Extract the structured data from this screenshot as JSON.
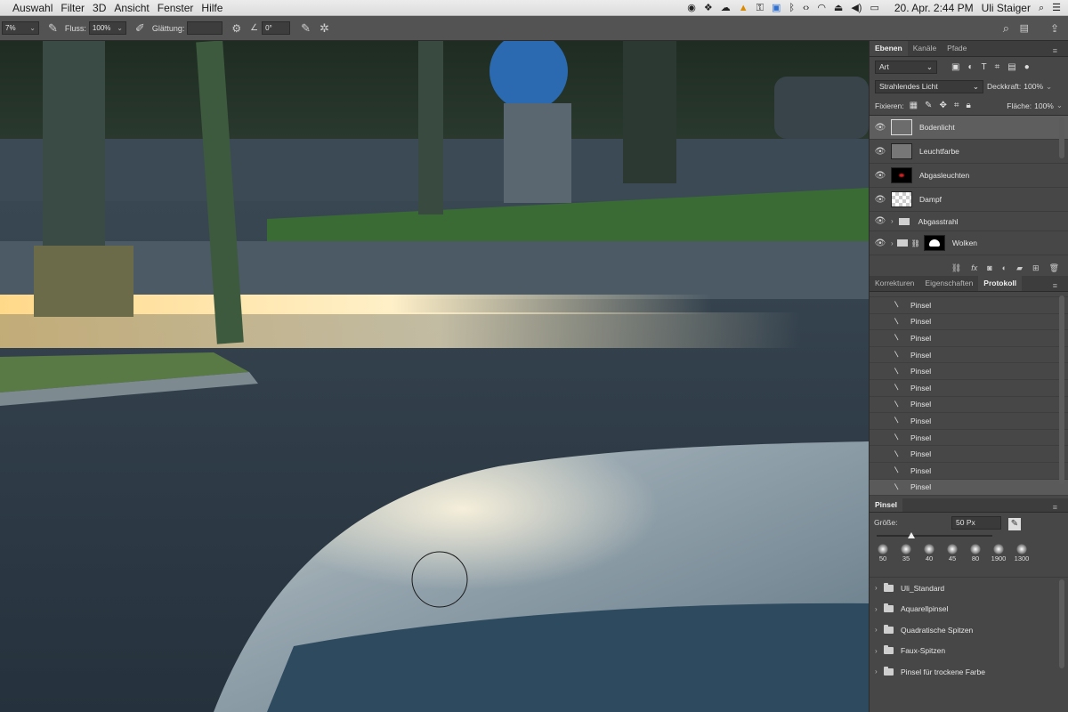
{
  "menubar": {
    "menus": [
      "Auswahl",
      "Filter",
      "3D",
      "Ansicht",
      "Fenster",
      "Hilfe"
    ],
    "datetime": "20. Apr.  2:44 PM",
    "user": "Uli Staiger"
  },
  "options": {
    "size_value": "7%",
    "flow_label": "Fluss:",
    "flow_value": "100%",
    "smoothing_label": "Glättung:",
    "smoothing_value": "",
    "angle_value": "0°"
  },
  "layers_panel": {
    "tabs": [
      "Ebenen",
      "Kanäle",
      "Pfade"
    ],
    "filter_kind": "Art",
    "blend_mode": "Strahlendes Licht",
    "opacity_label": "Deckkraft:",
    "opacity_value": "100%",
    "lock_label": "Fixieren:",
    "fill_label": "Fläche:",
    "fill_value": "100%",
    "layers": [
      {
        "name": "Bodenlicht",
        "type": "layer",
        "selected": true
      },
      {
        "name": "Leuchtfarbe",
        "type": "layer"
      },
      {
        "name": "Abgasleuchten",
        "type": "layer"
      },
      {
        "name": "Dampf",
        "type": "layer"
      },
      {
        "name": "Abgasstrahl",
        "type": "group"
      },
      {
        "name": "Wolken",
        "type": "group-masked"
      }
    ]
  },
  "history_panel": {
    "tabs": [
      "Korrekturen",
      "Eigenschaften",
      "Protokoll"
    ],
    "items": [
      "Pinsel",
      "Pinsel",
      "Pinsel",
      "Pinsel",
      "Pinsel",
      "Pinsel",
      "Pinsel",
      "Pinsel",
      "Pinsel",
      "Pinsel",
      "Pinsel",
      "Pinsel"
    ]
  },
  "brush_panel": {
    "title": "Pinsel",
    "size_label": "Größe:",
    "size_value": "50 Px",
    "size_slider_fraction": 0.27,
    "presets": [
      "50",
      "35",
      "40",
      "45",
      "80",
      "1900",
      "1300"
    ],
    "folders": [
      "Uli_Standard",
      "Aquarellpinsel",
      "Quadratische Spitzen",
      "Faux-Spitzen",
      "Pinsel für trockene Farbe"
    ]
  }
}
